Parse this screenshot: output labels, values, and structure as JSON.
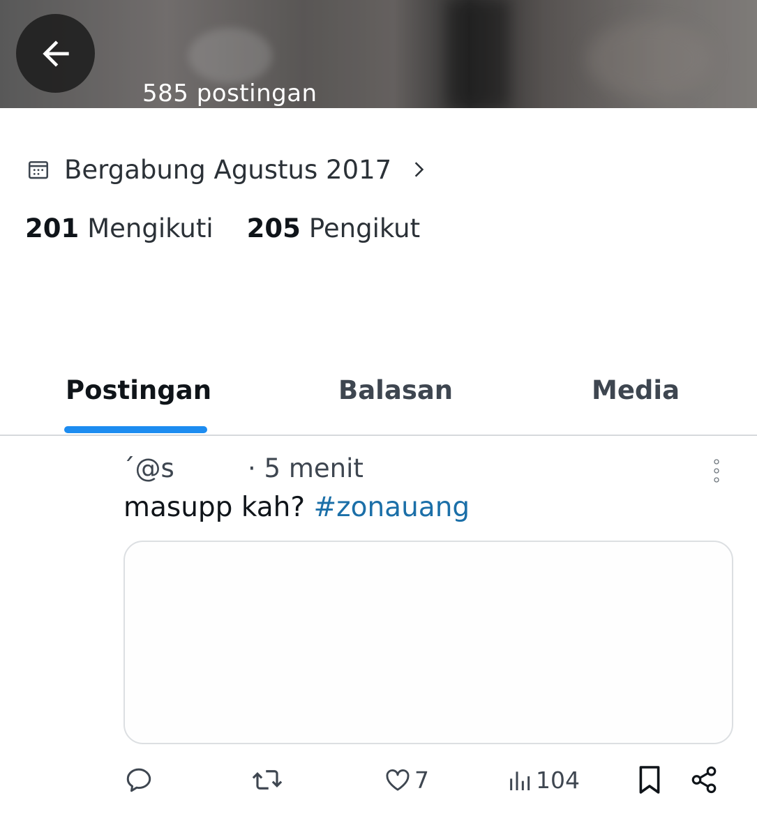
{
  "header": {
    "post_count": "585 postingan"
  },
  "profile": {
    "joined": "Bergabung Agustus 2017",
    "following_count": "201",
    "following_label": "Mengikuti",
    "followers_count": "205",
    "followers_label": "Pengikut"
  },
  "tabs": [
    {
      "label": "Postingan",
      "active": true
    },
    {
      "label": "Balasan",
      "active": false
    },
    {
      "label": "Media",
      "active": false
    }
  ],
  "post": {
    "handle": "ˊ@s",
    "time": "· 5 menit",
    "text": "masupp kah? ",
    "hashtag": "#zonauang",
    "likes": "7",
    "views": "104"
  },
  "colors": {
    "accent": "#1d8cf0",
    "hashtag": "#1b6fa8",
    "text": "#0f1419",
    "muted": "#3e4650"
  },
  "icons": [
    "back-arrow-icon",
    "calendar-icon",
    "chevron-right-icon",
    "more-vertical-icon",
    "reply-icon",
    "repost-icon",
    "like-icon",
    "views-icon",
    "bookmark-icon",
    "share-icon"
  ]
}
